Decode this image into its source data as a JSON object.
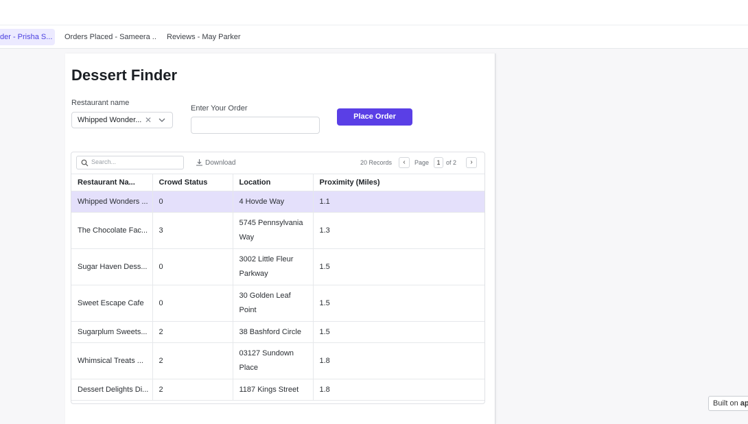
{
  "tabs": [
    {
      "label": "der - Prisha S...",
      "active": true
    },
    {
      "label": "Orders Placed - Sameera ...",
      "active": false
    },
    {
      "label": "Reviews - May Parker",
      "active": false
    }
  ],
  "page": {
    "title": "Dessert Finder",
    "restaurant_label": "Restaurant name",
    "restaurant_value": "Whipped Wonder...",
    "order_label": "Enter Your Order",
    "order_value": "",
    "place_order": "Place Order"
  },
  "table": {
    "search_placeholder": "Search...",
    "download": "Download",
    "records": "20 Records",
    "page_label": "Page",
    "page_current": "1",
    "page_of": "of 2",
    "columns": [
      "Restaurant Na...",
      "Crowd Status",
      "Location",
      "Proximity (Miles)"
    ],
    "rows": [
      {
        "name": "Whipped Wonders ...",
        "crowd": "0",
        "location": "4 Hovde Way",
        "proximity": "1.1",
        "selected": true
      },
      {
        "name": "The Chocolate Fac...",
        "crowd": "3",
        "location": "5745 Pennsylvania Way",
        "proximity": "1.3"
      },
      {
        "name": "Sugar Haven Dess...",
        "crowd": "0",
        "location": "3002 Little Fleur Parkway",
        "proximity": "1.5"
      },
      {
        "name": "Sweet Escape Cafe",
        "crowd": "0",
        "location": "30 Golden Leaf Point",
        "proximity": "1.5"
      },
      {
        "name": "Sugarplum Sweets...",
        "crowd": "2",
        "location": "38 Bashford Circle",
        "proximity": "1.5"
      },
      {
        "name": "Whimsical Treats ...",
        "crowd": "2",
        "location": "03127 Sundown Place",
        "proximity": "1.8"
      },
      {
        "name": "Dessert Delights Di...",
        "crowd": "2",
        "location": "1187 Kings Street",
        "proximity": "1.8"
      }
    ]
  },
  "footer": {
    "built_on": "Built on",
    "brand": "ap"
  },
  "colors": {
    "accent": "#5a3fe6",
    "selected_row": "#e4e0fb"
  }
}
